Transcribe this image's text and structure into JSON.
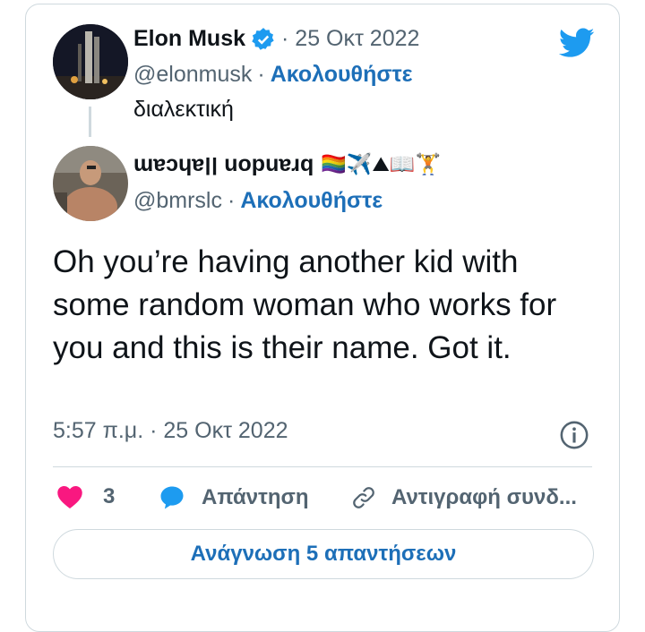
{
  "quoted_tweet": {
    "author_name": "Elon Musk",
    "date": "· 25 Οκτ 2022",
    "handle": "@elonmusk",
    "dot": "·",
    "follow_label": "Ακολουθήστε",
    "text": "διαλεκτική"
  },
  "main_tweet": {
    "author_name": "ɯɐɔɥɐןן uopuɐɹq",
    "author_emoji": "🏳️‍🌈✈️⛰📖🏋",
    "handle": "@bmrslc",
    "dot": "·",
    "follow_label": "Ακολουθήστε",
    "text": "Oh you’re having another kid with some random woman who works for you and this is their name. Got it.",
    "time": "5:57 π.μ. · 25 Οκτ 2022"
  },
  "actions": {
    "like_count": "3",
    "reply_label": "Απάντηση",
    "copy_link_label": "Αντιγραφή συνδ..."
  },
  "read_replies_label": "Ανάγνωση 5 απαντήσεων",
  "colors": {
    "twitter_blue": "#1d9bf0",
    "link_blue": "#1d6fb8",
    "heart_pink": "#f91880",
    "text_gray": "#536471",
    "border": "#cfd9de"
  }
}
